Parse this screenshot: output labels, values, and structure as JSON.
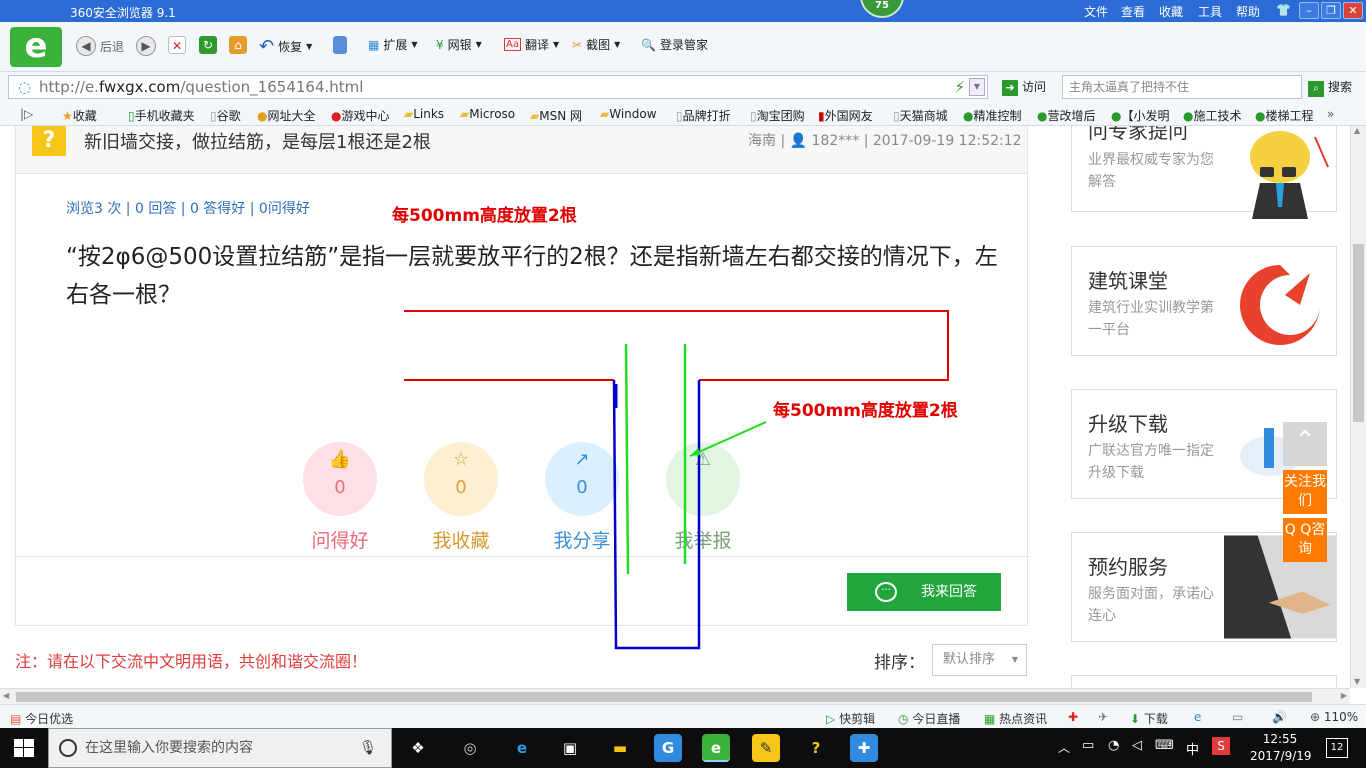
{
  "window": {
    "title": "360安全浏览器 9.1",
    "badge": "75",
    "menu": [
      "文件",
      "查看",
      "收藏",
      "工具",
      "帮助"
    ]
  },
  "toolbar": {
    "back": "后退",
    "restore": "恢复",
    "extensions": "扩展",
    "netbank": "网银",
    "translate": "翻译",
    "screenshot": "截图",
    "login_manager": "登录管家"
  },
  "address": {
    "prefix": "http://e.",
    "domain": "fwxgx.com",
    "path": "/question_1654164.html",
    "visit_label": "访问",
    "search_placeholder": "主角太逼真了把持不住",
    "search_label": "搜索"
  },
  "bookmarks": [
    "收藏",
    "手机收藏夹",
    "谷歌",
    "网址大全",
    "游戏中心",
    "Links",
    "Microso",
    "MSN 网",
    "Window",
    "品牌打折",
    "淘宝团购",
    "外国网友",
    "天猫商城",
    "精准控制",
    "营改增后",
    "【小发明",
    "施工技术",
    "楼梯工程"
  ],
  "question": {
    "title": "新旧墙交接，做拉结筋，是每层1根还是2根",
    "region": "海南",
    "user": "182***",
    "time": "2017-09-19 12:52:12",
    "stats": "浏览3 次 | 0 回答 | 0 答得好 | 0问得好",
    "text": "“按2φ6@500设置拉结筋”是指一层就要放平行的2根？还是指新墙左右都交接的情况下，左右各一根？",
    "annotation_top": "每500mm高度放置2根",
    "annotation_right": "每500mm高度放置2根",
    "actions": [
      {
        "icon": "👍",
        "count": "0",
        "label": "问得好"
      },
      {
        "icon": "☆",
        "count": "0",
        "label": "我收藏"
      },
      {
        "icon": "↗",
        "count": "0",
        "label": "我分享"
      },
      {
        "icon": "⚠",
        "count": "0",
        "label": "我举报"
      }
    ],
    "answer_button": "我来回答",
    "answer_icon": "···",
    "notice": "注：请在以下交流中文明用语，共创和谐交流圈！",
    "sort_label": "排序：",
    "sort_value": "默认排序"
  },
  "sidebar": {
    "cards": [
      {
        "title": "问专家提问",
        "desc": "业界最权威专家为您解答"
      },
      {
        "title": "建筑课堂",
        "desc": "建筑行业实训教学第一平台"
      },
      {
        "title": "升级下载",
        "desc": "广联达官方唯一指定升级下载"
      },
      {
        "title": "预约服务",
        "desc": "服务面对面，承诺心连心"
      }
    ],
    "float_buttons": [
      "关注我们",
      "Q Q咨询"
    ]
  },
  "statusbar": {
    "left": "今日优选",
    "items": [
      "快剪辑",
      "今日直播",
      "热点资讯",
      "下载"
    ],
    "zoom": "110%"
  },
  "taskbar": {
    "search_placeholder": "在这里输入你要搜索的内容",
    "time": "12:55",
    "date": "2017/9/19",
    "ime": "中",
    "notifications": "12"
  },
  "colors": {
    "titlebar": "#2b6bd6",
    "annotation_red": "#e00000",
    "annotation_blue": "#0000cc",
    "annotation_green": "#22dd22",
    "answer_green": "#21a53d",
    "float_orange": "#ff7a00"
  }
}
